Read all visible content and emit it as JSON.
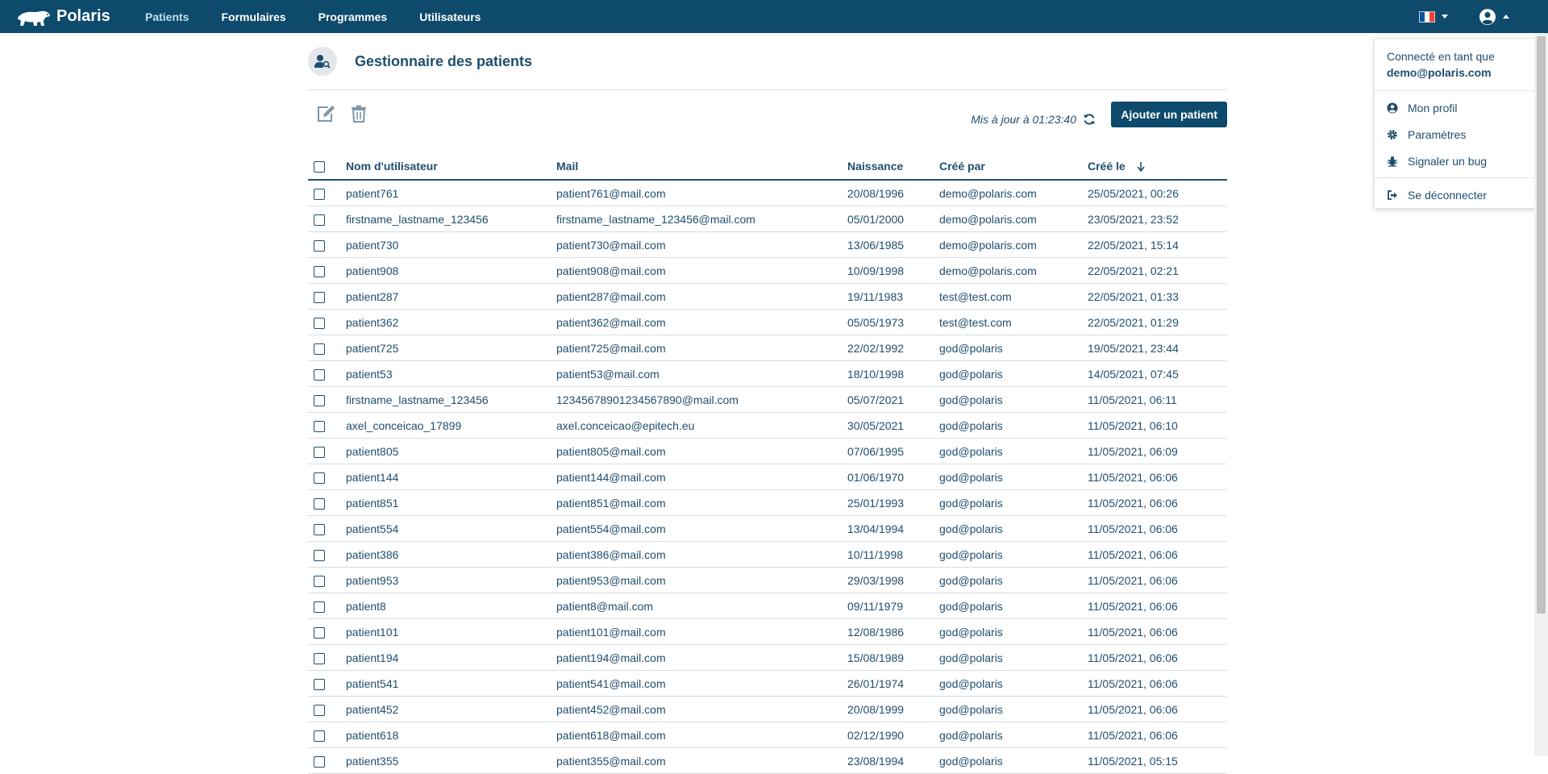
{
  "navbar": {
    "brand": "Polaris",
    "links": [
      "Patients",
      "Formulaires",
      "Programmes",
      "Utilisateurs"
    ],
    "active_link": "Patients"
  },
  "page": {
    "title": "Gestionnaire des patients",
    "updated_text": "Mis à jour à 01:23:40",
    "add_button": "Ajouter un patient"
  },
  "table": {
    "columns": [
      "Nom d'utilisateur",
      "Mail",
      "Naissance",
      "Créé par",
      "Créé le"
    ],
    "sorted_column": "Créé le",
    "sort_direction": "descending",
    "rows": [
      [
        "patient761",
        "patient761@mail.com",
        "20/08/1996",
        "demo@polaris.com",
        "25/05/2021, 00:26"
      ],
      [
        "firstname_lastname_123456",
        "firstname_lastname_123456@mail.com",
        "05/01/2000",
        "demo@polaris.com",
        "23/05/2021, 23:52"
      ],
      [
        "patient730",
        "patient730@mail.com",
        "13/06/1985",
        "demo@polaris.com",
        "22/05/2021, 15:14"
      ],
      [
        "patient908",
        "patient908@mail.com",
        "10/09/1998",
        "demo@polaris.com",
        "22/05/2021, 02:21"
      ],
      [
        "patient287",
        "patient287@mail.com",
        "19/11/1983",
        "test@test.com",
        "22/05/2021, 01:33"
      ],
      [
        "patient362",
        "patient362@mail.com",
        "05/05/1973",
        "test@test.com",
        "22/05/2021, 01:29"
      ],
      [
        "patient725",
        "patient725@mail.com",
        "22/02/1992",
        "god@polaris",
        "19/05/2021, 23:44"
      ],
      [
        "patient53",
        "patient53@mail.com",
        "18/10/1998",
        "god@polaris",
        "14/05/2021, 07:45"
      ],
      [
        "firstname_lastname_123456",
        "1234567890123456789​0@mail.com",
        "05/07/2021",
        "god@polaris",
        "11/05/2021, 06:11"
      ],
      [
        "axel_conceicao_17899",
        "axel.conceicao@epitech.eu",
        "30/05/2021",
        "god@polaris",
        "11/05/2021, 06:10"
      ],
      [
        "patient805",
        "patient805@mail.com",
        "07/06/1995",
        "god@polaris",
        "11/05/2021, 06:09"
      ],
      [
        "patient144",
        "patient144@mail.com",
        "01/06/1970",
        "god@polaris",
        "11/05/2021, 06:06"
      ],
      [
        "patient851",
        "patient851@mail.com",
        "25/01/1993",
        "god@polaris",
        "11/05/2021, 06:06"
      ],
      [
        "patient554",
        "patient554@mail.com",
        "13/04/1994",
        "god@polaris",
        "11/05/2021, 06:06"
      ],
      [
        "patient386",
        "patient386@mail.com",
        "10/11/1998",
        "god@polaris",
        "11/05/2021, 06:06"
      ],
      [
        "patient953",
        "patient953@mail.com",
        "29/03/1998",
        "god@polaris",
        "11/05/2021, 06:06"
      ],
      [
        "patient8",
        "patient8@mail.com",
        "09/11/1979",
        "god@polaris",
        "11/05/2021, 06:06"
      ],
      [
        "patient101",
        "patient101@mail.com",
        "12/08/1986",
        "god@polaris",
        "11/05/2021, 06:06"
      ],
      [
        "patient194",
        "patient194@mail.com",
        "15/08/1989",
        "god@polaris",
        "11/05/2021, 06:06"
      ],
      [
        "patient541",
        "patient541@mail.com",
        "26/01/1974",
        "god@polaris",
        "11/05/2021, 06:06"
      ],
      [
        "patient452",
        "patient452@mail.com",
        "20/08/1999",
        "god@polaris",
        "11/05/2021, 06:06"
      ],
      [
        "patient618",
        "patient618@mail.com",
        "02/12/1990",
        "god@polaris",
        "11/05/2021, 06:06"
      ],
      [
        "patient355",
        "patient355@mail.com",
        "23/08/1994",
        "god@polaris",
        "11/05/2021, 05:15"
      ]
    ]
  },
  "user_menu": {
    "connected_as": "Connecté en tant que",
    "email": "demo@polaris.com",
    "items": [
      {
        "label": "Mon profil",
        "icon": "user-circle-icon"
      },
      {
        "label": "Paramètres",
        "icon": "gear-icon"
      },
      {
        "label": "Signaler un bug",
        "icon": "bug-icon"
      },
      {
        "label": "Se déconnecter",
        "icon": "sign-out-icon"
      }
    ]
  },
  "colors": {
    "navbar": "#0d4a6b",
    "text": "#1f4e6e",
    "accent_button": "#0d4a6b",
    "flag": [
      "#0055a4",
      "#ffffff",
      "#ef4135"
    ]
  }
}
